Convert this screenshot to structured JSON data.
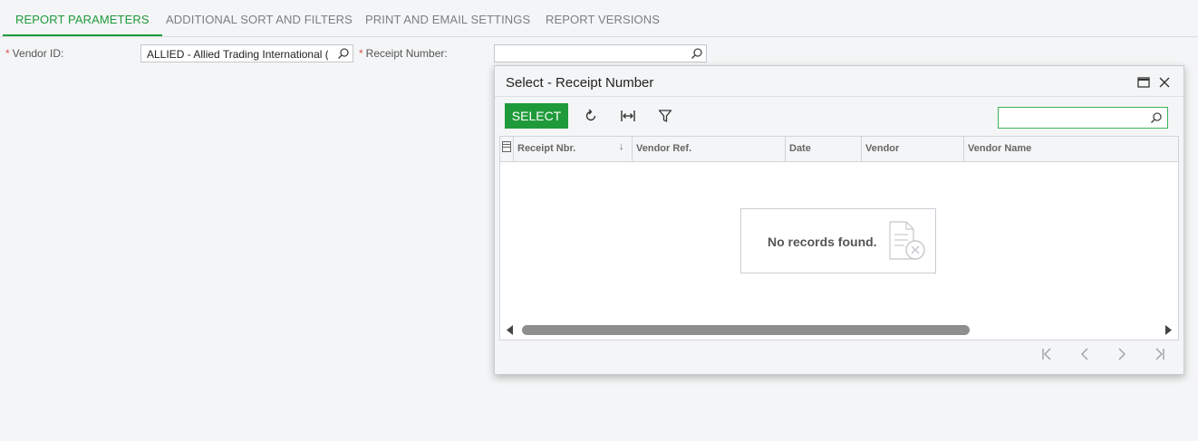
{
  "tabs": [
    {
      "label": "REPORT PARAMETERS",
      "active": true
    },
    {
      "label": "ADDITIONAL SORT AND FILTERS",
      "active": false
    },
    {
      "label": "PRINT AND EMAIL SETTINGS",
      "active": false
    },
    {
      "label": "REPORT VERSIONS",
      "active": false
    }
  ],
  "form": {
    "vendor_label": "Vendor ID:",
    "vendor_value": "ALLIED - Allied Trading International (I",
    "receipt_label": "Receipt Number:",
    "receipt_value": "",
    "required_mark": "*"
  },
  "dialog": {
    "title": "Select - Receipt Number",
    "select_label": "SELECT",
    "search_value": "",
    "columns": [
      "Receipt Nbr.",
      "Vendor Ref.",
      "Date",
      "Vendor",
      "Vendor Name"
    ],
    "sort_indicator": "↓",
    "empty_message": "No records found."
  },
  "colors": {
    "accent": "#1f9a3b",
    "required": "#d9534f"
  },
  "icons": [
    "search-icon",
    "maximize-icon",
    "close-icon",
    "refresh-icon",
    "fit-columns-icon",
    "filter-icon",
    "column-settings-icon",
    "no-records-icon",
    "first-page-icon",
    "prev-page-icon",
    "next-page-icon",
    "last-page-icon"
  ]
}
